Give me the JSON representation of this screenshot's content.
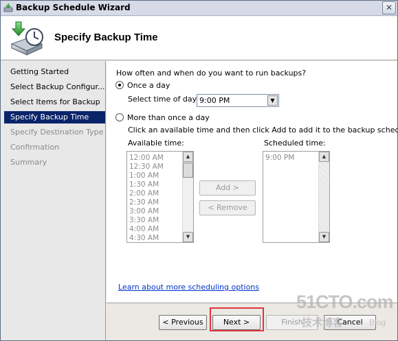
{
  "window": {
    "title": "Backup Schedule Wizard",
    "close_glyph": "✕"
  },
  "header": {
    "title": "Specify Backup Time",
    "icon": "backup-schedule-icon"
  },
  "steps": [
    {
      "label": "Getting Started",
      "state": "normal"
    },
    {
      "label": "Select Backup Configur...",
      "state": "normal"
    },
    {
      "label": "Select Items for Backup",
      "state": "normal"
    },
    {
      "label": "Specify Backup Time",
      "state": "active"
    },
    {
      "label": "Specify Destination Type",
      "state": "disabled"
    },
    {
      "label": "Confirmation",
      "state": "disabled"
    },
    {
      "label": "Summary",
      "state": "disabled"
    }
  ],
  "main": {
    "question": "How often and when do you want to run backups?",
    "once": {
      "label": "Once a day",
      "selected": true
    },
    "time_label": "Select time of day:",
    "time_value": "9:00 PM",
    "more": {
      "label": "More than once a day",
      "selected": false
    },
    "more_hint": "Click an available time and then click Add to add it to the backup schedule.",
    "available_label": "Available time:",
    "available_times": [
      "12:00 AM",
      "12:30 AM",
      "1:00 AM",
      "1:30 AM",
      "2:00 AM",
      "2:30 AM",
      "3:00 AM",
      "3:30 AM",
      "4:00 AM",
      "4:30 AM"
    ],
    "scheduled_label": "Scheduled time:",
    "scheduled_times": [
      "9:00 PM"
    ],
    "add_label": "Add >",
    "remove_label": "< Remove",
    "link": "Learn about more scheduling options"
  },
  "footer": {
    "previous": "< Previous",
    "next": "Next >",
    "finish": "Finish",
    "cancel": "Cancel"
  },
  "watermark": {
    "line1": "51CTO.com",
    "line2": "技术博客",
    "line3": "Blog"
  },
  "colors": {
    "active_step": "#0a246a",
    "link": "#0033cc",
    "highlight": "#e0323a"
  }
}
